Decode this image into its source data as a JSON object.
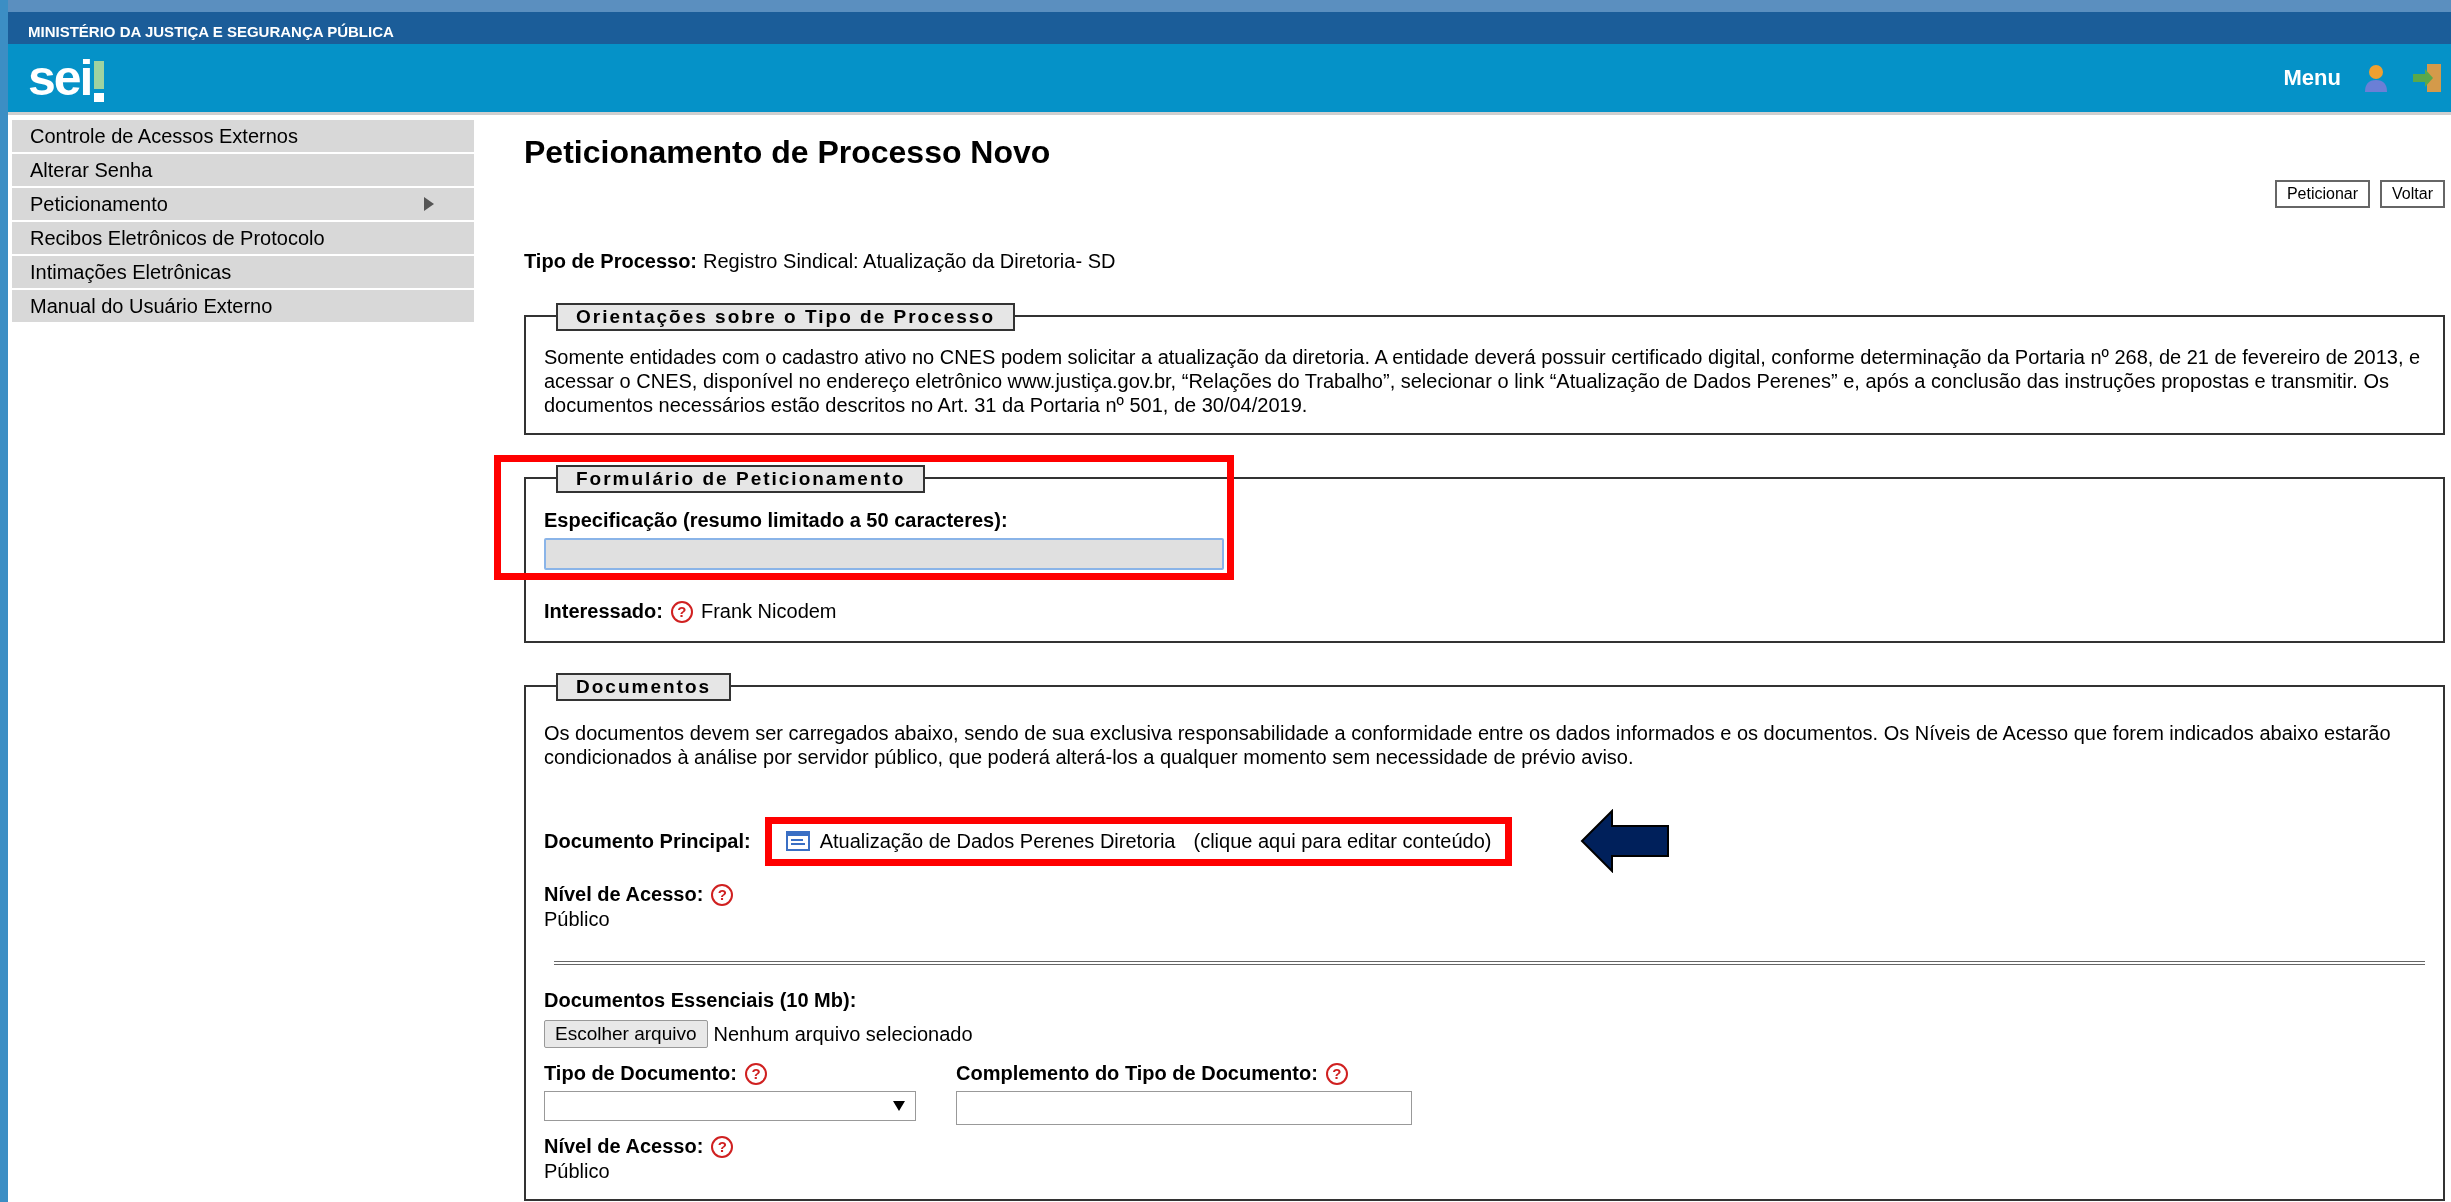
{
  "header": {
    "ministry": "MINISTÉRIO DA JUSTIÇA E SEGURANÇA PÚBLICA",
    "logo": "sei",
    "menu": "Menu"
  },
  "sidebar": {
    "items": [
      {
        "label": "Controle de Acessos Externos",
        "has_submenu": false
      },
      {
        "label": "Alterar Senha",
        "has_submenu": false
      },
      {
        "label": "Peticionamento",
        "has_submenu": true
      },
      {
        "label": "Recibos Eletrônicos de Protocolo",
        "has_submenu": false
      },
      {
        "label": "Intimações Eletrônicas",
        "has_submenu": false
      },
      {
        "label": "Manual do Usuário Externo",
        "has_submenu": false
      }
    ]
  },
  "page": {
    "title": "Peticionamento de Processo Novo",
    "buttons": [
      "Peticionar",
      "Voltar"
    ],
    "process_type": {
      "label": "Tipo de Processo:",
      "value": "Registro Sindical: Atualização da Diretoria- SD"
    }
  },
  "orientation": {
    "legend": "Orientações sobre o Tipo de Processo",
    "text": "Somente entidades com o cadastro ativo no CNES podem solicitar a atualização da diretoria. A entidade deverá possuir certificado digital, conforme determinação da Portaria nº 268, de 21 de fevereiro de 2013, e acessar o CNES, disponível no endereço eletrônico www.justiça.gov.br, “Relações do Trabalho”, selecionar o link “Atualização de Dados Perenes” e, após a conclusão das instruções propostas e transmitir. Os documentos necessários estão descritos no Art. 31 da Portaria nº 501, de 30/04/2019."
  },
  "form": {
    "legend": "Formulário de Peticionamento",
    "highlighted": true,
    "spec_label": "Especificação (resumo limitado a 50 caracteres):",
    "interested": {
      "label": "Interessado:",
      "help": "?",
      "value": "Frank Nicodem"
    }
  },
  "documents": {
    "legend": "Documentos",
    "text": "Os documentos devem ser carregados abaixo, sendo de sua exclusiva responsabilidade a conformidade entre os dados informados e os documentos. Os Níveis de Acesso que forem indicados abaixo estarão condicionados à análise por servidor público, que poderá alterá-los a qualquer momento sem necessidade de prévio aviso.",
    "main": {
      "label": "Documento Principal:",
      "link": "Atualização de Dados Perenes Diretoria",
      "hint": "(clique aqui para editar conteúdo)",
      "highlighted": true,
      "arrow": true
    },
    "main_access": {
      "label": "Nível de Acesso:",
      "help": "?",
      "value": "Público"
    },
    "essential": {
      "label": "Documentos Essenciais (10 Mb):",
      "file_button": "Escolher arquivo",
      "file_status": "Nenhum arquivo selecionado"
    },
    "doc_type": {
      "label": "Tipo de Documento:",
      "help": "?"
    },
    "complement": {
      "label": "Complemento do Tipo de Documento:",
      "help": "?"
    },
    "essential_access": {
      "label": "Nível de Acesso:",
      "help": "?",
      "value": "Público"
    }
  }
}
